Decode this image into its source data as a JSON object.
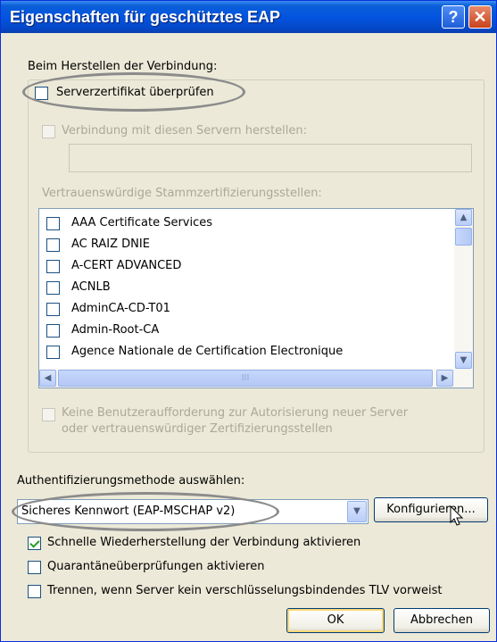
{
  "titlebar": {
    "title": "Eigenschaften für geschütztes EAP",
    "help_glyph": "?",
    "close_glyph": "✕"
  },
  "connection": {
    "heading": "Beim Herstellen der Verbindung:"
  },
  "validate_cert": {
    "label": "Serverzertifikat überprüfen",
    "checked": false
  },
  "connect_servers": {
    "label": "Verbindung mit diesen Servern herstellen:",
    "value": "",
    "enabled": false
  },
  "trusted_ca": {
    "heading": "Vertrauenswürdige Stammzertifizierungsstellen:",
    "items": [
      "AAA Certificate Services",
      "AC RAIZ DNIE",
      "A-CERT ADVANCED",
      "ACNLB",
      "AdminCA-CD-T01",
      "Admin-Root-CA",
      "Agence Nationale de Certification Electronique"
    ],
    "hscroll_grip": "III"
  },
  "no_prompt": {
    "line1": "Keine Benutzeraufforderung zur Autorisierung neuer Server",
    "line2": "oder vertrauenswürdiger Zertifizierungsstellen",
    "enabled": false
  },
  "auth": {
    "heading": "Authentifizierungsmethode auswählen:",
    "selected": "Sicheres Kennwort (EAP-MSCHAP v2)",
    "configure_label": "Konfigurieren..."
  },
  "options": {
    "fast_reconnect": {
      "label": "Schnelle Wiederherstellung der Verbindung aktivieren",
      "checked": true
    },
    "quarantine": {
      "label": "Quarantäneüberprüfungen aktivieren",
      "checked": false
    },
    "disconnect_tlv": {
      "label": "Trennen, wenn Server kein verschlüsselungsbindendes TLV vorweist",
      "checked": false
    }
  },
  "footer": {
    "ok_label": "OK",
    "cancel_label": "Abbrechen"
  },
  "icons": {
    "help": "help-icon",
    "close": "close-icon",
    "scroll_up": "scroll-up-arrow-icon",
    "scroll_down": "scroll-down-arrow-icon",
    "scroll_left": "scroll-left-arrow-icon",
    "scroll_right": "scroll-right-arrow-icon",
    "dropdown": "chevron-down-icon",
    "cursor": "mouse-pointer-icon"
  },
  "colors": {
    "titlebar": "#0454e0",
    "window_bg": "#ece9d8",
    "annotation": "#8b8b8b"
  }
}
